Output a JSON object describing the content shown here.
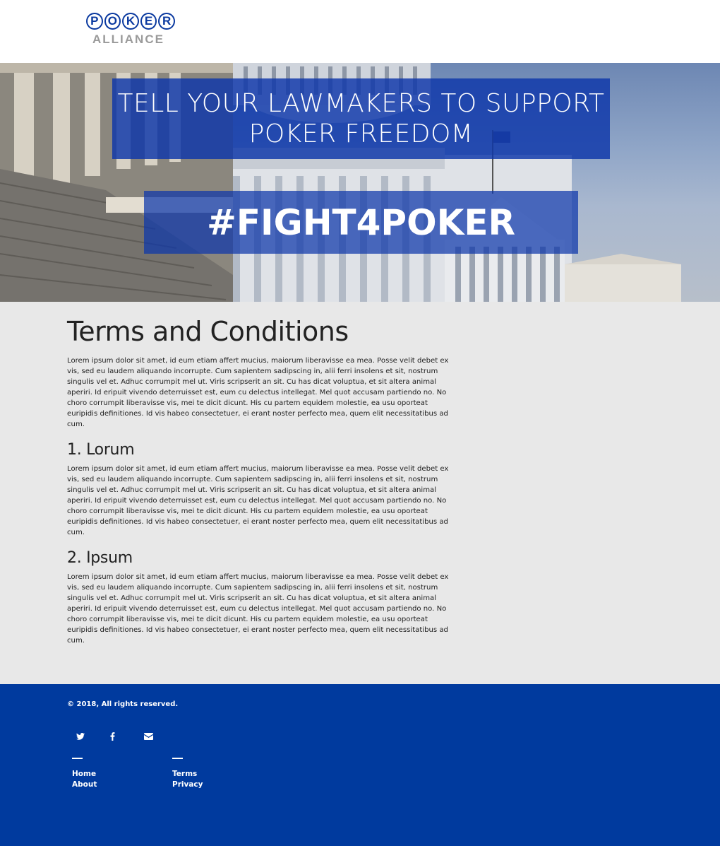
{
  "header": {
    "logo_letters": [
      "P",
      "O",
      "K",
      "E",
      "R"
    ],
    "logo_subtitle": "ALLIANCE"
  },
  "hero": {
    "headline_line1": "TELL YOUR LAWMAKERS TO SUPPORT",
    "headline_line2": "POKER FREEDOM",
    "hashtag": "#FIGHT4POKER"
  },
  "main": {
    "title": "Terms and Conditions",
    "intro": "Lorem ipsum dolor sit amet, id eum etiam affert mucius, maiorum liberavisse ea mea. Posse velit debet ex vis, sed eu laudem aliquando incorrupte. Cum sapientem sadipscing in, alii ferri insolens et sit, nostrum singulis vel et. Adhuc corrumpit mel ut. Viris scripserit an sit. Cu has dicat voluptua, et sit altera animal aperiri. Id eripuit vivendo deterruisset est, eum cu delectus intellegat. Mel quot accusam partiendo no. No choro corrumpit liberavisse vis, mei te dicit dicunt. His cu partem equidem molestie, ea usu oporteat euripidis definitiones. Id vis habeo consectetuer, ei erant noster perfecto mea, quem elit necessitatibus ad cum.",
    "sections": [
      {
        "heading": "1. Lorum",
        "body": "Lorem ipsum dolor sit amet, id eum etiam affert mucius, maiorum liberavisse ea mea. Posse velit debet ex vis, sed eu laudem aliquando incorrupte. Cum sapientem sadipscing in, alii ferri insolens et sit, nostrum singulis vel et. Adhuc corrumpit mel ut. Viris scripserit an sit. Cu has dicat voluptua, et sit altera animal aperiri. Id eripuit vivendo deterruisset est, eum cu delectus intellegat. Mel quot accusam partiendo no. No choro corrumpit liberavisse vis, mei te dicit dicunt. His cu partem equidem molestie, ea usu oporteat euripidis definitiones. Id vis habeo consectetuer, ei erant noster perfecto mea, quem elit necessitatibus ad cum."
      },
      {
        "heading": "2. Ipsum",
        "body": "Lorem ipsum dolor sit amet, id eum etiam affert mucius, maiorum liberavisse ea mea. Posse velit debet ex vis, sed eu laudem aliquando incorrupte. Cum sapientem sadipscing in, alii ferri insolens et sit, nostrum singulis vel et. Adhuc corrumpit mel ut. Viris scripserit an sit. Cu has dicat voluptua, et sit altera animal aperiri. Id eripuit vivendo deterruisset est, eum cu delectus intellegat. Mel quot accusam partiendo no. No choro corrumpit liberavisse vis, mei te dicit dicunt. His cu partem equidem molestie, ea usu oporteat euripidis definitiones. Id vis habeo consectetuer, ei erant noster perfecto mea, quem elit necessitatibus ad cum."
      }
    ]
  },
  "footer": {
    "copyright": "© 2018, All rights reserved.",
    "social_icons": [
      "twitter-icon",
      "facebook-icon",
      "envelope-icon"
    ],
    "links_col1": [
      "Home",
      "About"
    ],
    "links_col2": [
      "Terms",
      "Privacy"
    ]
  },
  "colors": {
    "brand_blue": "#003a9e",
    "hero_overlay": "#0c36aa",
    "content_bg": "#e8e8e8"
  }
}
